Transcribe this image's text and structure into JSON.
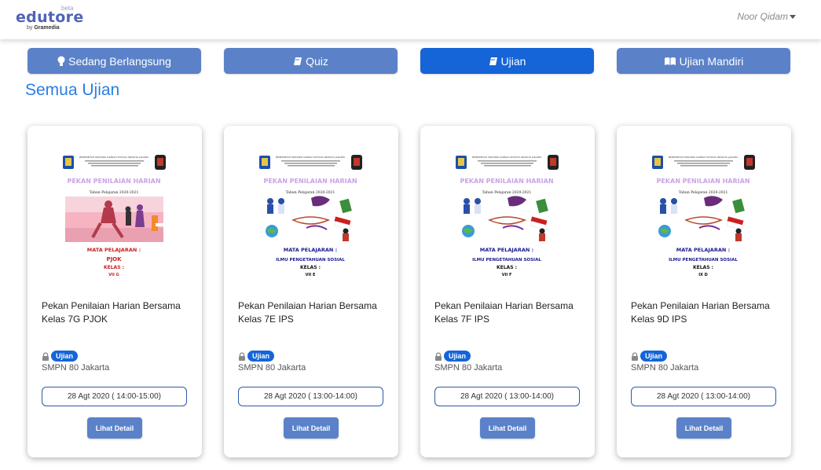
{
  "brand": {
    "name": "edutore",
    "beta": "beta",
    "by": "by",
    "publisher": "Gramedia"
  },
  "user": {
    "name": "Noor Qidam"
  },
  "tabs": [
    {
      "label": "Sedang Berlangsung",
      "icon": "lightbulb-icon",
      "active": false
    },
    {
      "label": "Quiz",
      "icon": "book-icon",
      "active": false
    },
    {
      "label": "Ujian",
      "icon": "book-icon",
      "active": true
    },
    {
      "label": "Ujian Mandiri",
      "icon": "open-book-icon",
      "active": false
    }
  ],
  "section": {
    "title": "Semua Ujian"
  },
  "cards": [
    {
      "title": "Pekan Penilaian Harian Bersama Kelas 7G PJOK",
      "badge": "Ujian",
      "school": "SMPN 80 Jakarta",
      "date": "28 Agt 2020 ( 14:00-15:00)",
      "button": "Lihat Detail",
      "poster": {
        "subject": "PJOK",
        "kelas": "VII G",
        "theme": "sports"
      }
    },
    {
      "title": "Pekan Penilaian Harian Bersama Kelas 7E IPS",
      "badge": "Ujian",
      "school": "SMPN 80 Jakarta",
      "date": "28 Agt 2020 ( 13:00-14:00)",
      "button": "Lihat Detail",
      "poster": {
        "subject": "ILMU PENGETAHUAN SOSIAL",
        "kelas": "VII E",
        "theme": "indonesia"
      }
    },
    {
      "title": "Pekan Penilaian Harian Bersama Kelas 7F IPS",
      "badge": "Ujian",
      "school": "SMPN 80 Jakarta",
      "date": "28 Agt 2020 ( 13:00-14:00)",
      "button": "Lihat Detail",
      "poster": {
        "subject": "ILMU PENGETAHUAN SOSIAL",
        "kelas": "VII F",
        "theme": "indonesia"
      }
    },
    {
      "title": "Pekan Penilaian Harian Bersama Kelas 9D IPS",
      "badge": "Ujian",
      "school": "SMPN 80 Jakarta",
      "date": "28 Agt 2020 ( 13:00-14:00)",
      "button": "Lihat Detail",
      "poster": {
        "subject": "ILMU PENGETAHUAN SOSIAL",
        "kelas": "IX D",
        "theme": "indonesia"
      }
    }
  ],
  "poster_common": {
    "header": "PEMERINTAH PROVINSI DAERAH KHUSUS IBUKOTA JAKARTA",
    "heading": "PEKAN PENILAIAN HARIAN",
    "year": "Tahun Pelajaran 2020-2021",
    "mapel": "MATA PELAJARAN :",
    "kelas_label": "KELAS :"
  },
  "colors": {
    "accent": "#1565d8",
    "tab": "#5b82c9",
    "title": "#2a7de1"
  }
}
